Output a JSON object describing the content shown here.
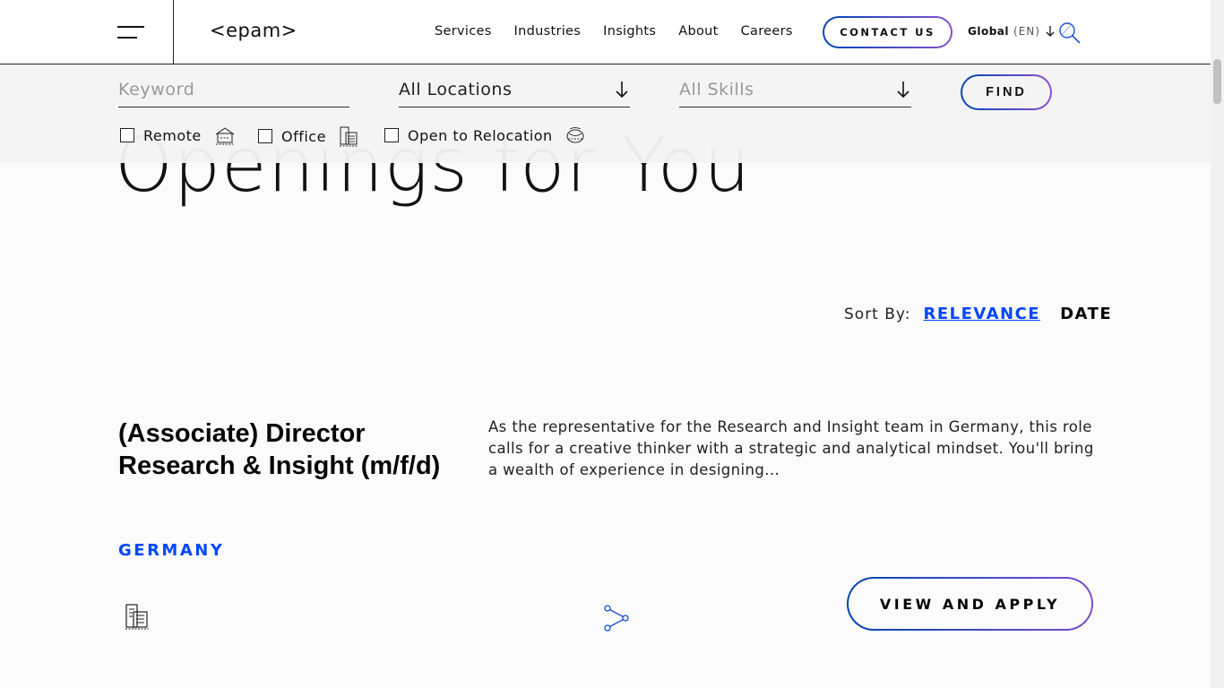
{
  "header": {
    "logo": "<epam>",
    "nav": [
      "Services",
      "Industries",
      "Insights",
      "About",
      "Careers"
    ],
    "contact_label": "CONTACT US",
    "lang_region": "Global",
    "lang_code": "(EN)"
  },
  "filters": {
    "keyword_placeholder": "Keyword",
    "location_label": "All Locations",
    "skills_label": "All Skills",
    "find_label": "FIND",
    "remote_label": "Remote",
    "office_label": "Office",
    "relocation_label": "Open to Relocation"
  },
  "page": {
    "hero_title": "Openings for You"
  },
  "sort": {
    "label": "Sort By:",
    "relevance": "RELEVANCE",
    "date": "DATE"
  },
  "job": {
    "title": "(Associate) Director Research & Insight (m/f/d)",
    "country": "GERMANY",
    "description": "As the representative for the Research and Insight team in Germany, this role calls for a creative thinker with a strategic and analytical mindset. You'll bring a wealth of experience in designing...",
    "apply_label": "VIEW AND APPLY"
  },
  "colors": {
    "accent_blue": "#0047ff",
    "gradient_start": "#0047b3",
    "gradient_end": "#8a4fd0"
  },
  "icons": [
    "hamburger-icon",
    "search-icon",
    "arrow-down-icon",
    "remote-house-icon",
    "office-building-icon",
    "relocation-globe-icon",
    "share-icon"
  ]
}
